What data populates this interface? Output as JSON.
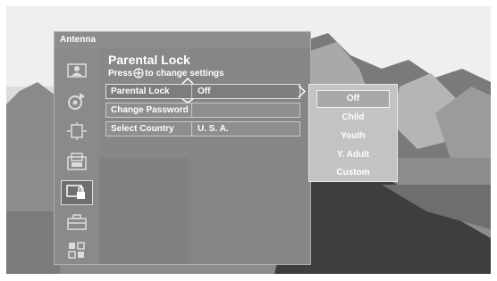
{
  "menu": {
    "title": "Antenna",
    "heading": "Parental Lock",
    "subheading_pre": "Press",
    "subheading_post": "to change settings"
  },
  "sidebar": {
    "items": [
      {
        "icon": "picture-icon"
      },
      {
        "icon": "sound-icon"
      },
      {
        "icon": "screen-icon"
      },
      {
        "icon": "channel-icon"
      },
      {
        "icon": "parental-lock-icon",
        "selected": true
      },
      {
        "icon": "setup-toolbox-icon"
      },
      {
        "icon": "applications-icon"
      }
    ]
  },
  "settings": [
    {
      "label": "Parental Lock",
      "value": "Off"
    },
    {
      "label": "Change Password",
      "value": ""
    },
    {
      "label": "Select Country",
      "value": "U. S. A."
    }
  ],
  "dropdown": {
    "options": [
      "Off",
      "Child",
      "Youth",
      "Y. Adult",
      "Custom"
    ],
    "selected": "Off"
  }
}
